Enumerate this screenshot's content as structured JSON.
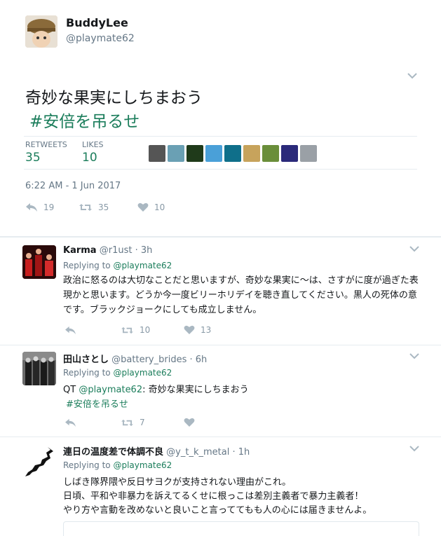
{
  "main_tweet": {
    "name": "BuddyLee",
    "handle": "@playmate62",
    "text_line1": "奇妙な果実にしちまおう",
    "hashtag": "#安倍を吊るせ",
    "retweets_label": "RETWEETS",
    "retweets_count": "35",
    "likes_label": "LIKES",
    "likes_count": "10",
    "timestamp": "6:22 AM - 1 Jun 2017",
    "actions": {
      "reply": "19",
      "retweet": "35",
      "like": "10"
    }
  },
  "replies": [
    {
      "name": "Karma",
      "handle": "@r1ust",
      "time": "· 3h",
      "replying_label": "Replying to ",
      "replying_to": "@playmate62",
      "text": "政治に怒るのは大切なことだと思いますが、奇妙な果実に〜は、さすがに度が過ぎた表現かと思います。どうか今一度ビリーホリデイを聴き直してください。黒人の死体の意です。ブラックジョークにしても成立しません。",
      "actions": {
        "reply": "",
        "retweet": "10",
        "like": "13"
      }
    },
    {
      "name": "田山さとし",
      "handle": "@battery_brides",
      "time": "· 6h",
      "replying_label": "Replying to ",
      "replying_to": "@playmate62",
      "qt_prefix": "QT ",
      "qt_handle": "@playmate62",
      "qt_text": ": 奇妙な果実にしちまおう",
      "qt_hashtag": "#安倍を吊るせ",
      "actions": {
        "reply": "",
        "retweet": "7",
        "like": ""
      }
    },
    {
      "name": "連日の温度差で体調不良",
      "handle": "@y_t_k_metal",
      "time": "· 1h",
      "replying_label": "Replying to ",
      "replying_to": "@playmate62",
      "line1": "しばき隊界隈や反日サヨクが支持されない理由がこれ。",
      "line2": "日頃、平和や非暴力を訴えてるくせに根っこは差別主義者で暴力主義者！",
      "line3": "やり方や言動を改めないと良いこと言っててもも人の心には届きませんよ。"
    }
  ],
  "colors": {
    "accent": "#1b7d5b",
    "muted": "#657786",
    "divider": "#e6ecf0"
  }
}
